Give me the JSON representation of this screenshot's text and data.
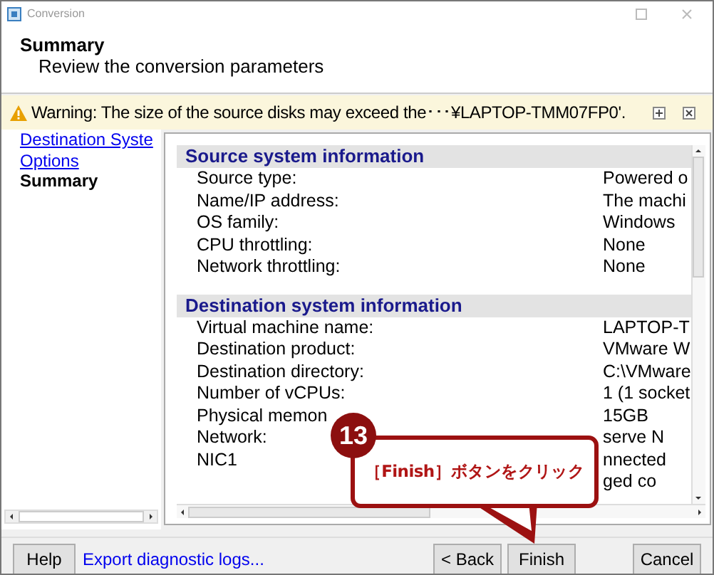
{
  "window": {
    "title": "Conversion"
  },
  "header": {
    "title": "Summary",
    "subtitle": "Review the conversion parameters"
  },
  "warning": {
    "text": "Warning: The size of the source disks may exceed the･･･¥LAPTOP-TMM07FP0'."
  },
  "sidebar": {
    "items": [
      {
        "label": "Destination Syste",
        "kind": "link",
        "selected": false
      },
      {
        "label": "Options",
        "kind": "link",
        "selected": false
      },
      {
        "label": "Summary",
        "kind": "current",
        "selected": true
      }
    ]
  },
  "sections": [
    {
      "title": "Source system information",
      "rows": [
        {
          "label": "Source type:",
          "value": "Powered o"
        },
        {
          "label": "Name/IP address:",
          "value": "The machi"
        },
        {
          "label": "OS family:",
          "value": "Windows"
        },
        {
          "label": "CPU throttling:",
          "value": "None"
        },
        {
          "label": "Network throttling:",
          "value": "None"
        }
      ]
    },
    {
      "title": "Destination system information",
      "rows": [
        {
          "label": "Virtual machine name:",
          "value": "LAPTOP-T"
        },
        {
          "label": "Destination product:",
          "value": "VMware W"
        },
        {
          "label": "Destination directory:",
          "value": "C:\\VMware"
        },
        {
          "label": "Number of vCPUs:",
          "value": "1 (1 socket"
        },
        {
          "label": "Physical memon",
          "value": "15GB"
        },
        {
          "label": "Network:",
          "value": "serve N"
        },
        {
          "label": "NIC1",
          "value": "nnected"
        },
        {
          "label": "",
          "value": "ged co"
        }
      ]
    }
  ],
  "callout": {
    "step": "13",
    "text": "［Finish］ボタンをクリック"
  },
  "footer": {
    "help": "Help",
    "link": "Export diagnostic logs...",
    "back": "< Back",
    "finish": "Finish",
    "cancel": "Cancel"
  }
}
